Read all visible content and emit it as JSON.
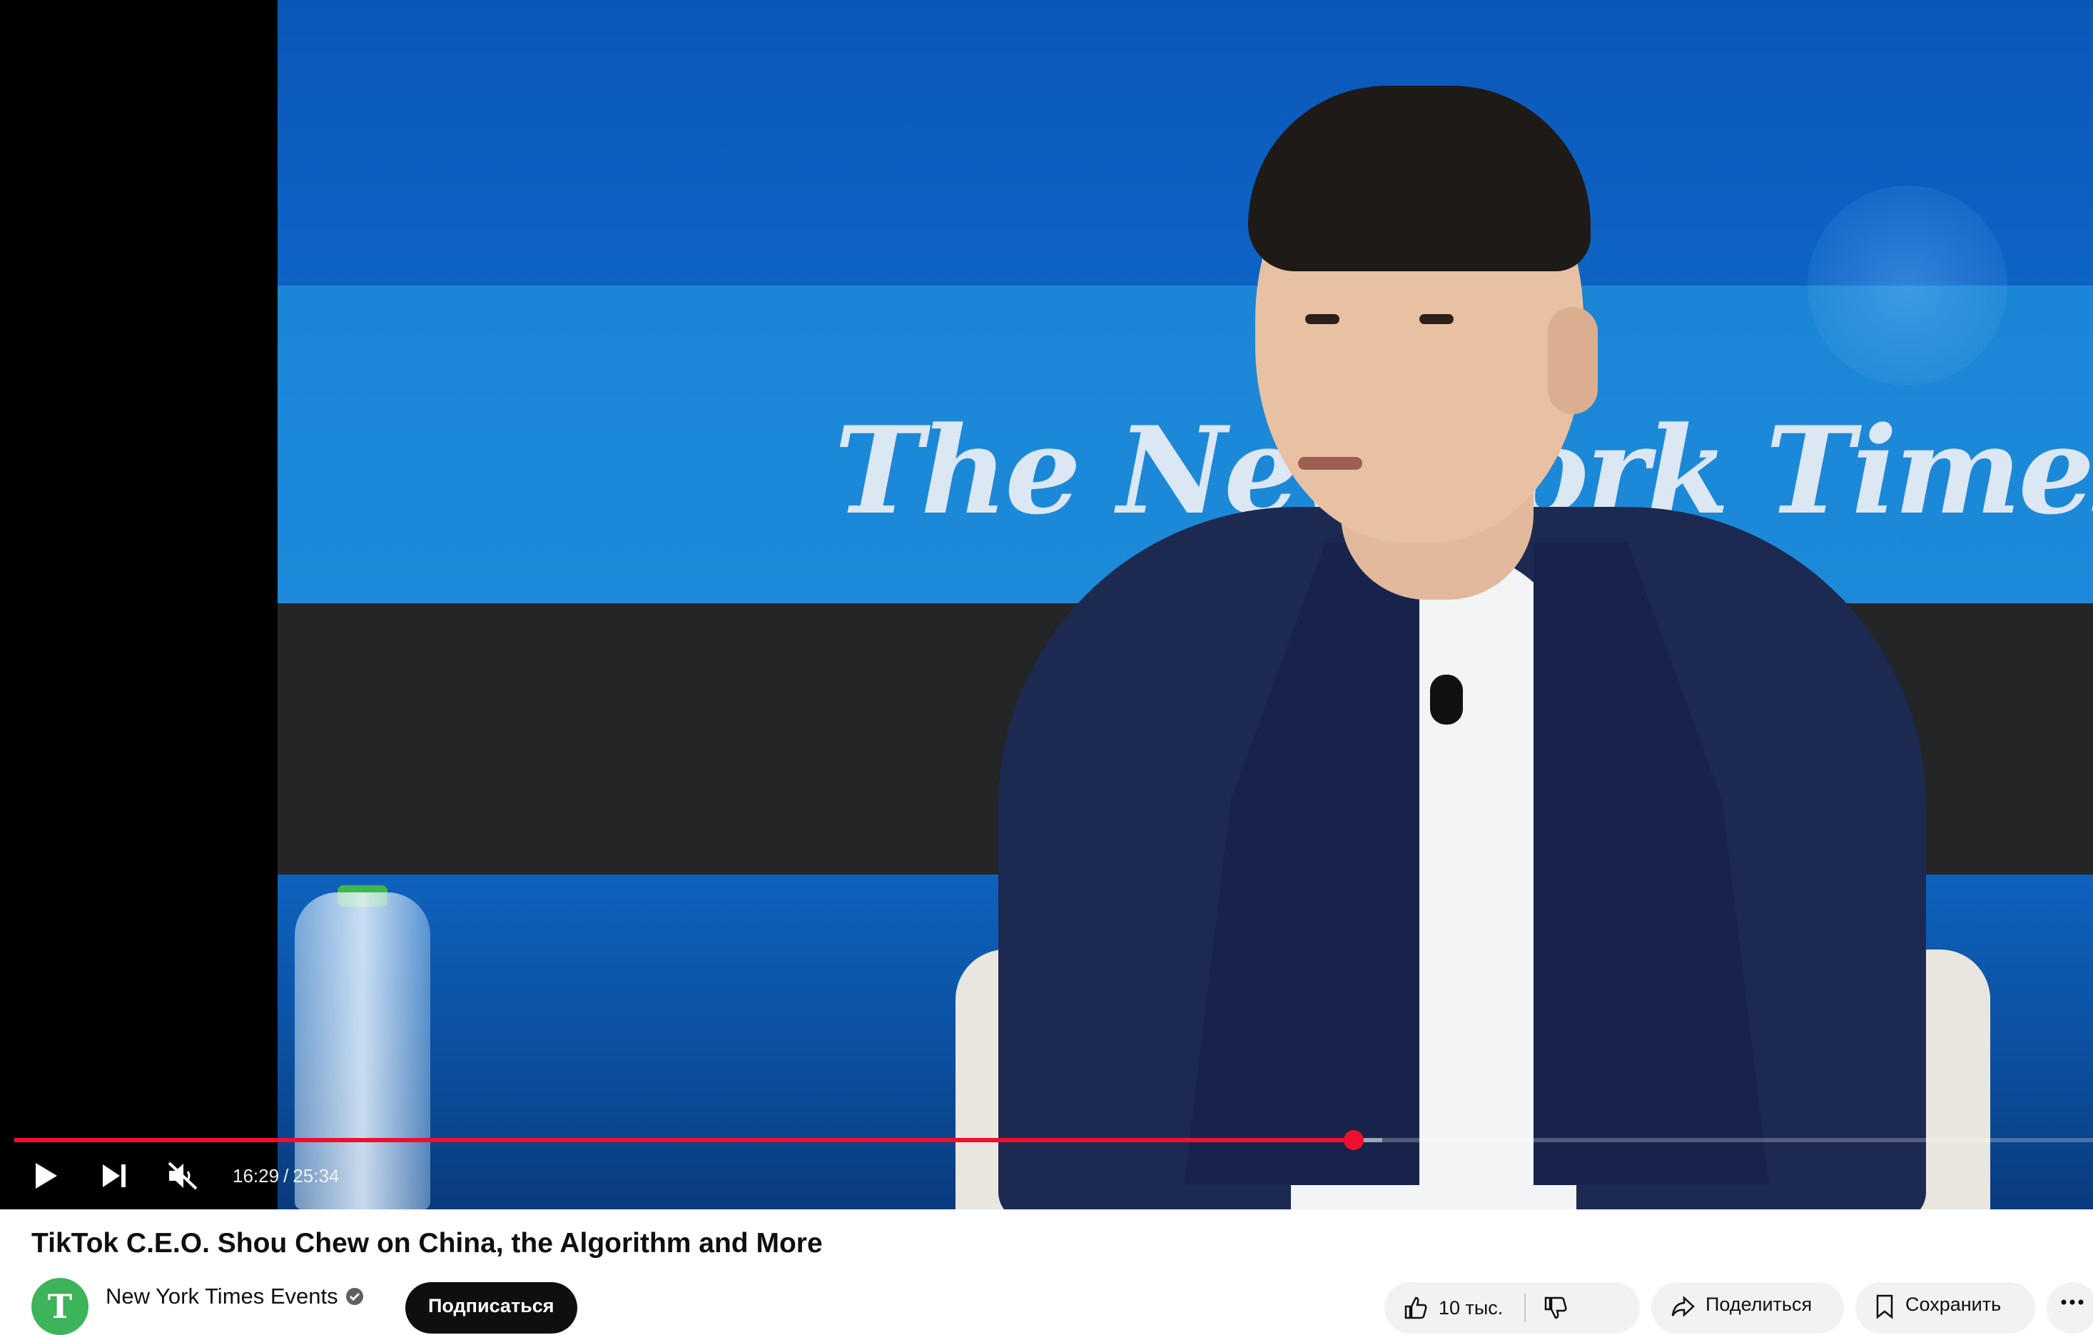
{
  "player": {
    "time": {
      "current": "16:29",
      "duration": "25:34"
    },
    "progress_played_fraction": 0.6445,
    "progress_buffered_fraction": 0.6582,
    "muted": true,
    "controls": {
      "play": "play-icon",
      "next": "skip-next-icon",
      "mute": "volume-muted-icon"
    },
    "backdrop_text": "The New York Times"
  },
  "video": {
    "title": "TikTok C.E.O. Shou Chew on China, the Algorithm and More"
  },
  "channel": {
    "name": "New York Times Events",
    "avatar_letter": "T",
    "verified_icon": "verified-check-icon",
    "subscribe_label": "Подписаться"
  },
  "actions": {
    "like_count": "10 тыс.",
    "share_label": "Поделиться",
    "save_label": "Сохранить",
    "more_icon": "more-horizontal-icon"
  },
  "colors": {
    "progress_played": "#f00f2e",
    "subscribe_bg": "#0f0f0f",
    "pill_bg": "#f2f2f2",
    "avatar_bg": "#3db35a"
  }
}
